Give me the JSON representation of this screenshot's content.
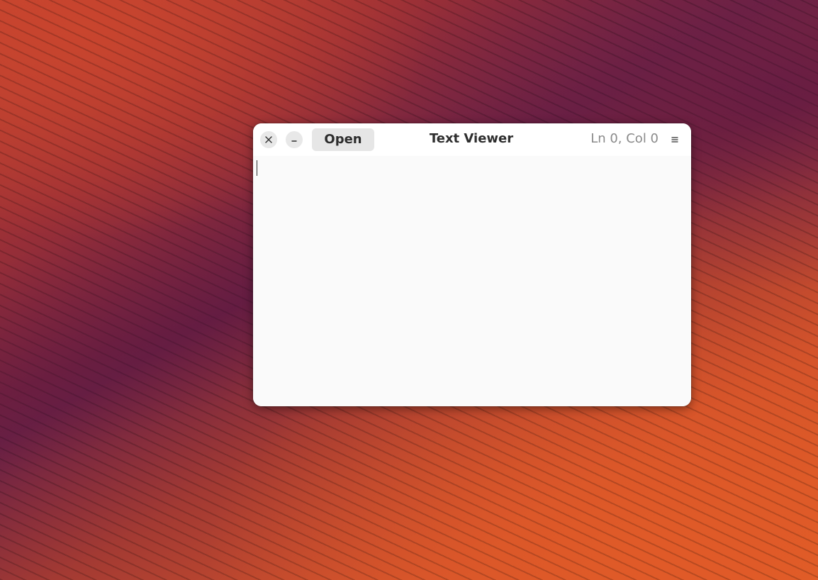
{
  "desktop": {
    "wallpaper": "orange-purple-cubes"
  },
  "window": {
    "title": "Text Viewer",
    "open_label": "Open",
    "cursor_position": "Ln 0, Col 0",
    "icons": {
      "close": "close-icon",
      "minimize": "minimize-icon",
      "menu": "hamburger-menu-icon"
    },
    "editor": {
      "content": ""
    }
  },
  "colors": {
    "window_bg": "#fafafa",
    "headerbar_bg": "#ffffff",
    "button_bg": "#e6e6e6",
    "text": "#2e2e2e",
    "dim_text": "#8a8a8a"
  }
}
